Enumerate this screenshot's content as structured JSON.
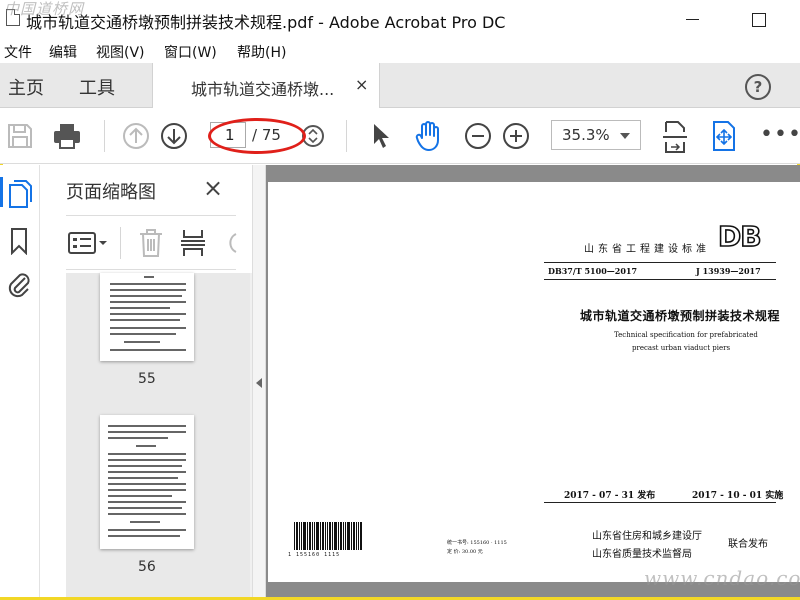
{
  "titlebar": {
    "title": "城市轨道交通桥墩预制拼装技术规程.pdf - Adobe Acrobat Pro DC",
    "watermark": "中国道桥网"
  },
  "menu": [
    "文件",
    "编辑",
    "视图(V)",
    "窗口(W)",
    "帮助(H)"
  ],
  "tabs": {
    "home": "主页",
    "tools": "工具",
    "document": "城市轨道交通桥墩...",
    "close": "×",
    "help": "?"
  },
  "toolbar": {
    "current_page": "1",
    "total_pages": "/ 75",
    "zoom": "35.3%",
    "more": "•••"
  },
  "panel": {
    "title": "页面缩略图",
    "close": "×",
    "thumbnails": [
      {
        "label": "55"
      },
      {
        "label": "56"
      }
    ]
  },
  "document": {
    "std_class": "山东省工程建设标准",
    "logo": "DB",
    "std_number": "DB37/T 5100—2017",
    "j_number": "J 13939—2017",
    "title": "城市轨道交通桥墩预制拼装技术规程",
    "subtitle_line1": "Technical specification for prefabricated",
    "subtitle_line2": "precast urban viaduct piers",
    "issue_date": "2017 - 07 - 31 发布",
    "impl_date": "2017 - 10 - 01 实施",
    "barcode_number": "1 155160 1115",
    "unified_number": "统一书号: 155160 · 1115",
    "price": "定    价: 30.00 元",
    "issuer1": "山东省住房和城乡建设厅",
    "issuer2": "山东省质量技术监督局",
    "joint_issue": "联合发布"
  },
  "watermark_bottom": "www.cndao.com",
  "colors": {
    "frame": "#f2d726",
    "accent": "#1473e6",
    "annotation": "#e0201a"
  }
}
